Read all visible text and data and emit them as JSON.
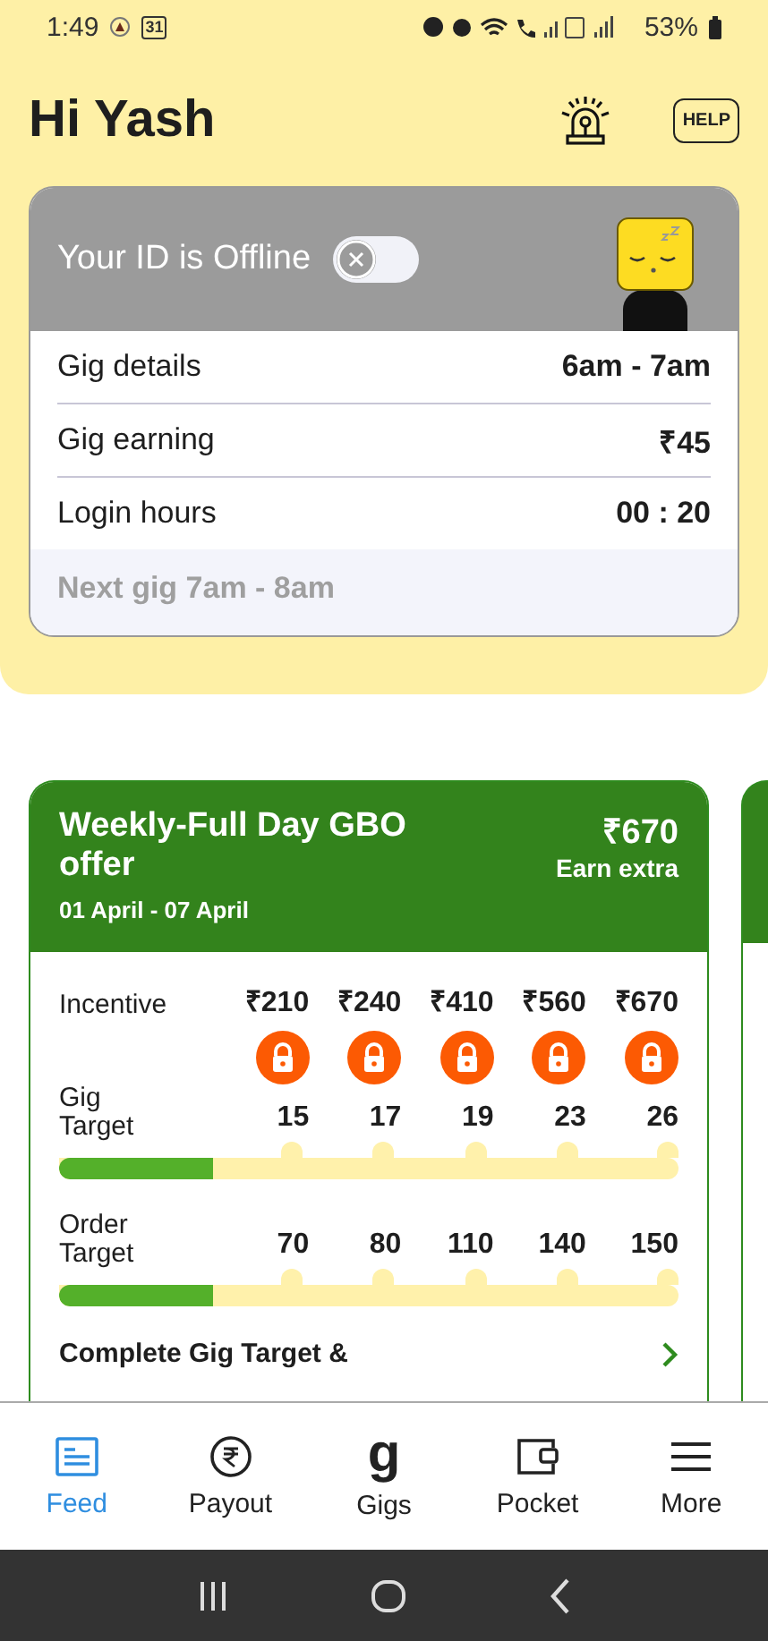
{
  "status_bar": {
    "time": "1:49",
    "calendar_date": "31",
    "battery": "53%"
  },
  "header": {
    "greeting": "Hi Yash",
    "help_label": "HELP"
  },
  "status_card": {
    "title": "Your ID is Offline",
    "online": false,
    "rows": [
      {
        "label": "Gig details",
        "value": "6am - 7am"
      },
      {
        "label": "Gig earning",
        "value": "₹45"
      },
      {
        "label": "Login hours",
        "value": "00 : 20"
      }
    ],
    "next_gig": "Next gig 7am - 8am"
  },
  "offer_card": {
    "title": "Weekly-Full Day GBO offer",
    "dates": "01 April - 07 April",
    "amount": "₹670",
    "amount_caption": "Earn extra",
    "incentive_label": "Incentive",
    "incentives": [
      {
        "amount": "₹210",
        "locked": true
      },
      {
        "amount": "₹240",
        "locked": true
      },
      {
        "amount": "₹410",
        "locked": true
      },
      {
        "amount": "₹560",
        "locked": true
      },
      {
        "amount": "₹670",
        "locked": true
      }
    ],
    "targets": [
      {
        "label": "Gig Target",
        "values": [
          "15",
          "17",
          "19",
          "23",
          "26"
        ],
        "level": 0.25
      },
      {
        "label": "Order Target",
        "values": [
          "70",
          "80",
          "110",
          "140",
          "150"
        ],
        "level": 0.25
      }
    ],
    "footer_text": "Complete Gig Target &"
  },
  "bottom_nav": [
    {
      "kind": "feed",
      "label": "Feed",
      "selected": true
    },
    {
      "kind": "payout",
      "label": "Payout",
      "selected": false
    },
    {
      "kind": "gigs",
      "label": "Gigs",
      "glyph": "g",
      "selected": false
    },
    {
      "kind": "pocket",
      "label": "Pocket",
      "selected": false
    },
    {
      "kind": "more",
      "label": "More",
      "selected": false
    }
  ]
}
